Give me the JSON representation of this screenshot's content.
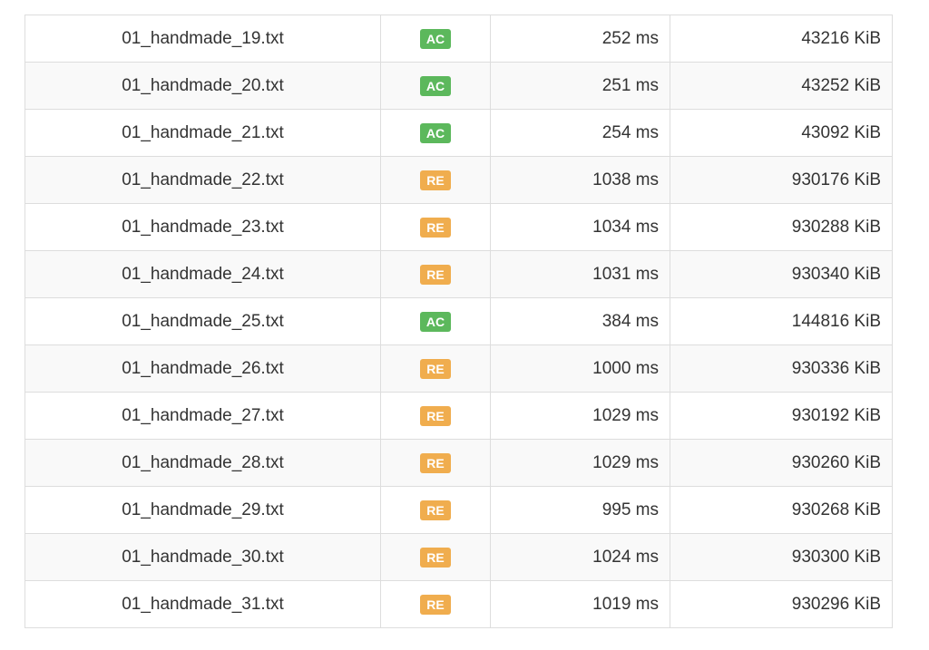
{
  "colors": {
    "AC": "#5cb85c",
    "RE": "#f0ad4e"
  },
  "rows": [
    {
      "name": "01_handmade_19.txt",
      "status": "AC",
      "time": "252 ms",
      "memory": "43216 KiB"
    },
    {
      "name": "01_handmade_20.txt",
      "status": "AC",
      "time": "251 ms",
      "memory": "43252 KiB"
    },
    {
      "name": "01_handmade_21.txt",
      "status": "AC",
      "time": "254 ms",
      "memory": "43092 KiB"
    },
    {
      "name": "01_handmade_22.txt",
      "status": "RE",
      "time": "1038 ms",
      "memory": "930176 KiB"
    },
    {
      "name": "01_handmade_23.txt",
      "status": "RE",
      "time": "1034 ms",
      "memory": "930288 KiB"
    },
    {
      "name": "01_handmade_24.txt",
      "status": "RE",
      "time": "1031 ms",
      "memory": "930340 KiB"
    },
    {
      "name": "01_handmade_25.txt",
      "status": "AC",
      "time": "384 ms",
      "memory": "144816 KiB"
    },
    {
      "name": "01_handmade_26.txt",
      "status": "RE",
      "time": "1000 ms",
      "memory": "930336 KiB"
    },
    {
      "name": "01_handmade_27.txt",
      "status": "RE",
      "time": "1029 ms",
      "memory": "930192 KiB"
    },
    {
      "name": "01_handmade_28.txt",
      "status": "RE",
      "time": "1029 ms",
      "memory": "930260 KiB"
    },
    {
      "name": "01_handmade_29.txt",
      "status": "RE",
      "time": "995 ms",
      "memory": "930268 KiB"
    },
    {
      "name": "01_handmade_30.txt",
      "status": "RE",
      "time": "1024 ms",
      "memory": "930300 KiB"
    },
    {
      "name": "01_handmade_31.txt",
      "status": "RE",
      "time": "1019 ms",
      "memory": "930296 KiB"
    }
  ]
}
